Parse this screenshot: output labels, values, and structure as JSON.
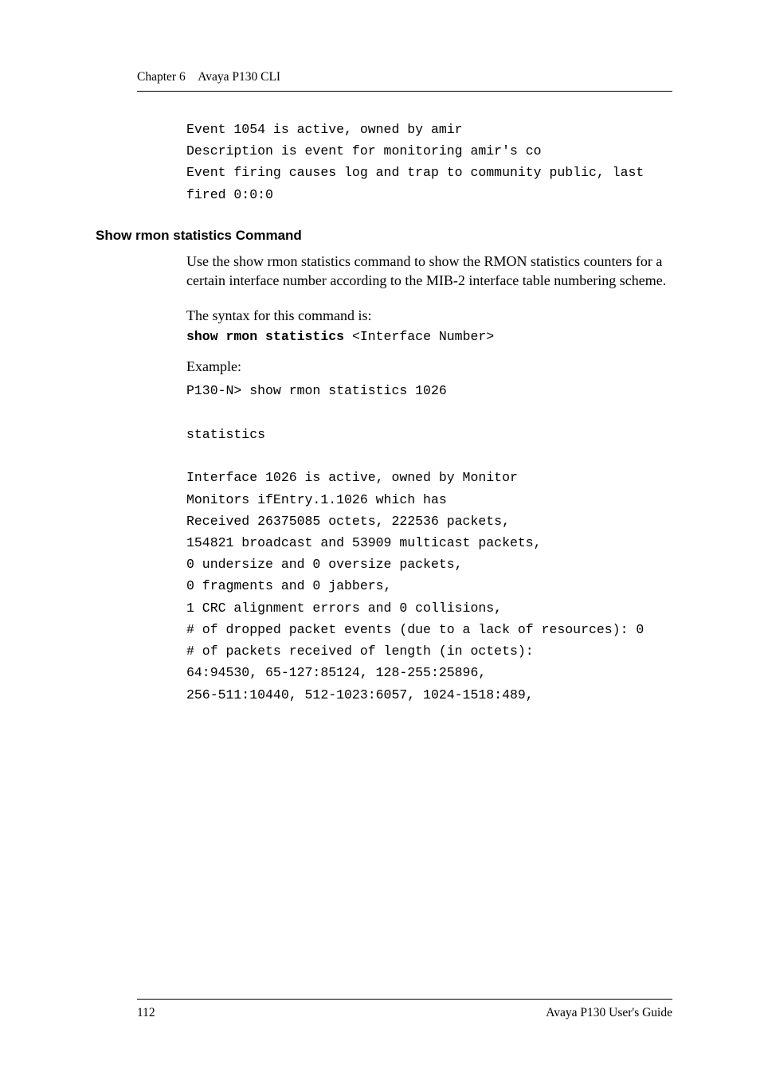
{
  "running_head": {
    "chapter": "Chapter 6",
    "title": "Avaya P130 CLI"
  },
  "top_code": {
    "l1": "Event 1054 is active, owned by amir",
    "l2": "Description is event for monitoring amir's co",
    "l3": "Event firing causes log and trap to community public, last fired 0:0:0"
  },
  "section": {
    "heading": "Show rmon statistics Command",
    "para": "Use the show rmon statistics command to show the RMON statistics counters for a certain interface number according to the MIB-2 interface table numbering scheme.",
    "syntax_intro": "The syntax for this command is:",
    "syntax_cmd_bold": "show rmon statistics",
    "syntax_cmd_rest": " <Interface Number>",
    "example_label": "Example:",
    "example_cmd": "P130-N> show rmon statistics 1026",
    "stats_header": "statistics",
    "lines": {
      "l1": "Interface 1026 is active, owned by Monitor",
      "l2": "Monitors ifEntry.1.1026 which has",
      "l3": "Received 26375085 octets, 222536 packets,",
      "l4": "154821 broadcast and 53909 multicast packets,",
      "l5": "0 undersize and 0 oversize packets,",
      "l6": "0 fragments and 0 jabbers,",
      "l7": "1 CRC alignment errors and 0 collisions,",
      "l8": "# of dropped packet events (due to a lack of resources): 0",
      "l9": "# of packets received of length (in octets):",
      "l10": "64:94530, 65-127:85124, 128-255:25896,",
      "l11": "256-511:10440, 512-1023:6057, 1024-1518:489,"
    }
  },
  "footer": {
    "page_number": "112",
    "doc_title": "Avaya P130 User's Guide"
  }
}
